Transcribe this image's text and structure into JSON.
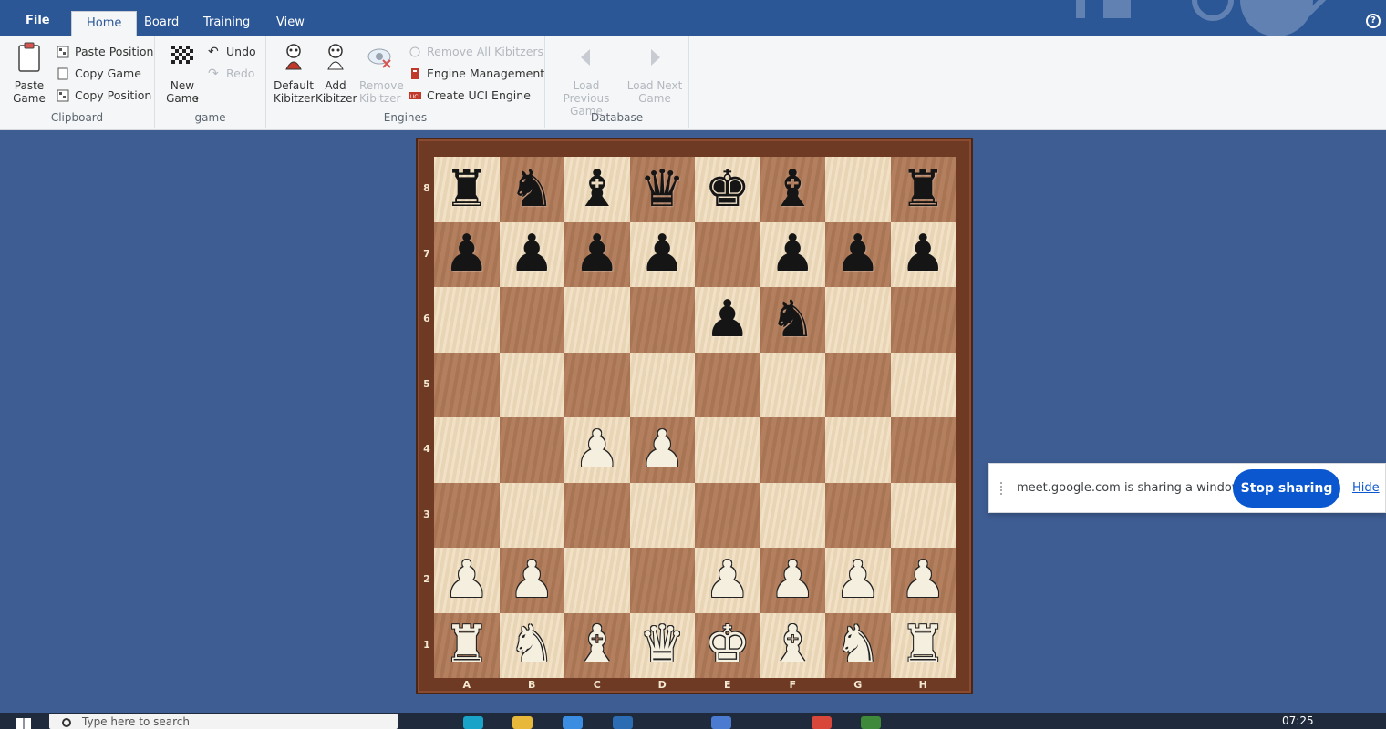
{
  "tabs": {
    "file": "File",
    "home": "Home",
    "board": "Board",
    "training": "Training",
    "view": "View"
  },
  "ribbon": {
    "clipboard": {
      "label": "Clipboard",
      "paste_game": "Paste Game",
      "paste_position": "Paste Position",
      "copy_game": "Copy Game",
      "copy_position": "Copy Position"
    },
    "game": {
      "label": "game",
      "new_game": "New Game",
      "undo": "Undo",
      "redo": "Redo"
    },
    "engines": {
      "label": "Engines",
      "default_kibitzer": "Default Kibitzer",
      "add_kibitzer": "Add Kibitzer",
      "remove_kibitzer": "Remove Kibitzer",
      "remove_all_kibitzers": "Remove All Kibitzers",
      "engine_management": "Engine Management",
      "create_uci_engine": "Create UCI Engine"
    },
    "database": {
      "label": "Database",
      "load_previous_game": "Load Previous Game",
      "load_next_game": "Load Next Game"
    }
  },
  "board": {
    "files": [
      "A",
      "B",
      "C",
      "D",
      "E",
      "F",
      "G",
      "H"
    ],
    "ranks": [
      "8",
      "7",
      "6",
      "5",
      "4",
      "3",
      "2",
      "1"
    ],
    "position": [
      [
        "br",
        "bn",
        "bb",
        "bq",
        "bk",
        "bb",
        "",
        "br"
      ],
      [
        "bp",
        "bp",
        "bp",
        "bp",
        "",
        "bp",
        "bp",
        "bp"
      ],
      [
        "",
        "",
        "",
        "",
        "bp",
        "bn",
        "",
        ""
      ],
      [
        "",
        "",
        "",
        "",
        "",
        "",
        "",
        ""
      ],
      [
        "",
        "",
        "wp",
        "wp",
        "",
        "",
        "",
        ""
      ],
      [
        "",
        "",
        "",
        "",
        "",
        "",
        "",
        ""
      ],
      [
        "wp",
        "wp",
        "",
        "",
        "wp",
        "wp",
        "wp",
        "wp"
      ],
      [
        "wr",
        "wn",
        "wb",
        "wq",
        "wk",
        "wb",
        "wn",
        "wr"
      ]
    ]
  },
  "sharebar": {
    "message": "meet.google.com is sharing a window.",
    "stop_label": "Stop sharing",
    "hide_label": "Hide"
  },
  "taskbar": {
    "search_placeholder": "Type here to search",
    "clock": "07:25"
  }
}
